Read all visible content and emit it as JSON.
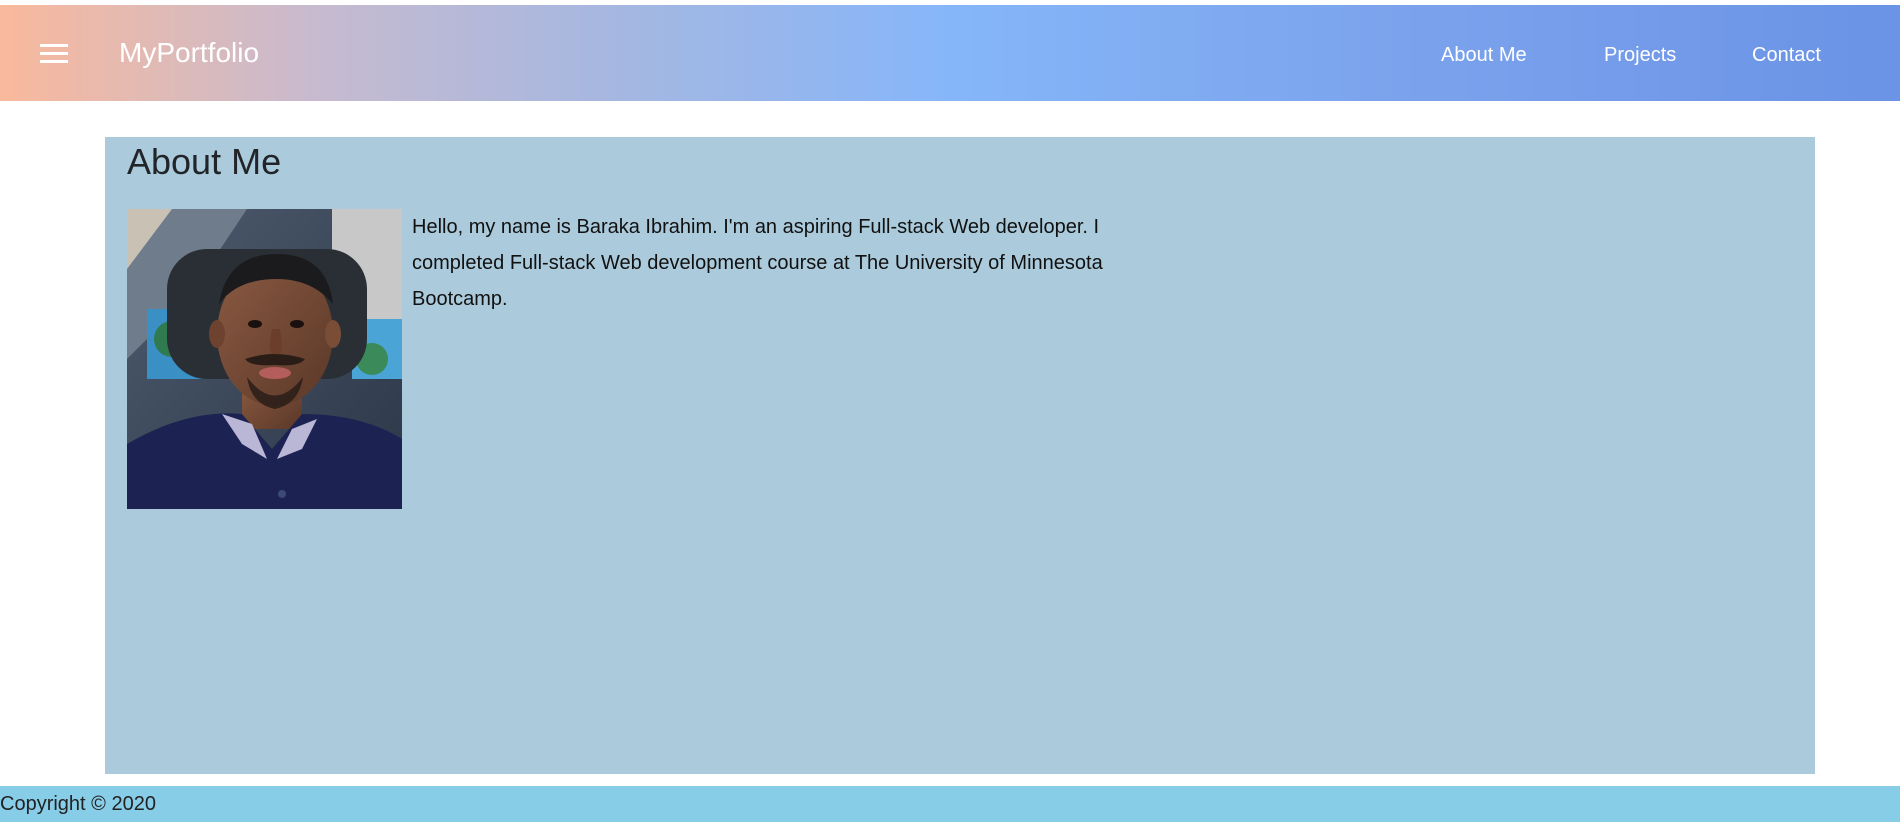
{
  "navbar": {
    "brand": "MyPortfolio",
    "menu_icon": "hamburger-menu-icon",
    "links": [
      {
        "label": "About Me"
      },
      {
        "label": "Projects"
      },
      {
        "label": "Contact"
      }
    ]
  },
  "main": {
    "title": "About Me",
    "bio": "Hello, my name is Baraka Ibrahim. I'm an aspiring Full-stack Web developer. I completed Full-stack Web development course at The University of Minnesota Bootcamp.",
    "portrait_subject": "profile-photo"
  },
  "footer": {
    "text": "Copyright © 2020"
  },
  "colors": {
    "card_background": "#abcbdc",
    "footer_background": "#87cde8",
    "nav_gradient_start": "#f9b99c",
    "nav_gradient_mid": "#86b6fa",
    "nav_gradient_end": "#6b93e6"
  }
}
